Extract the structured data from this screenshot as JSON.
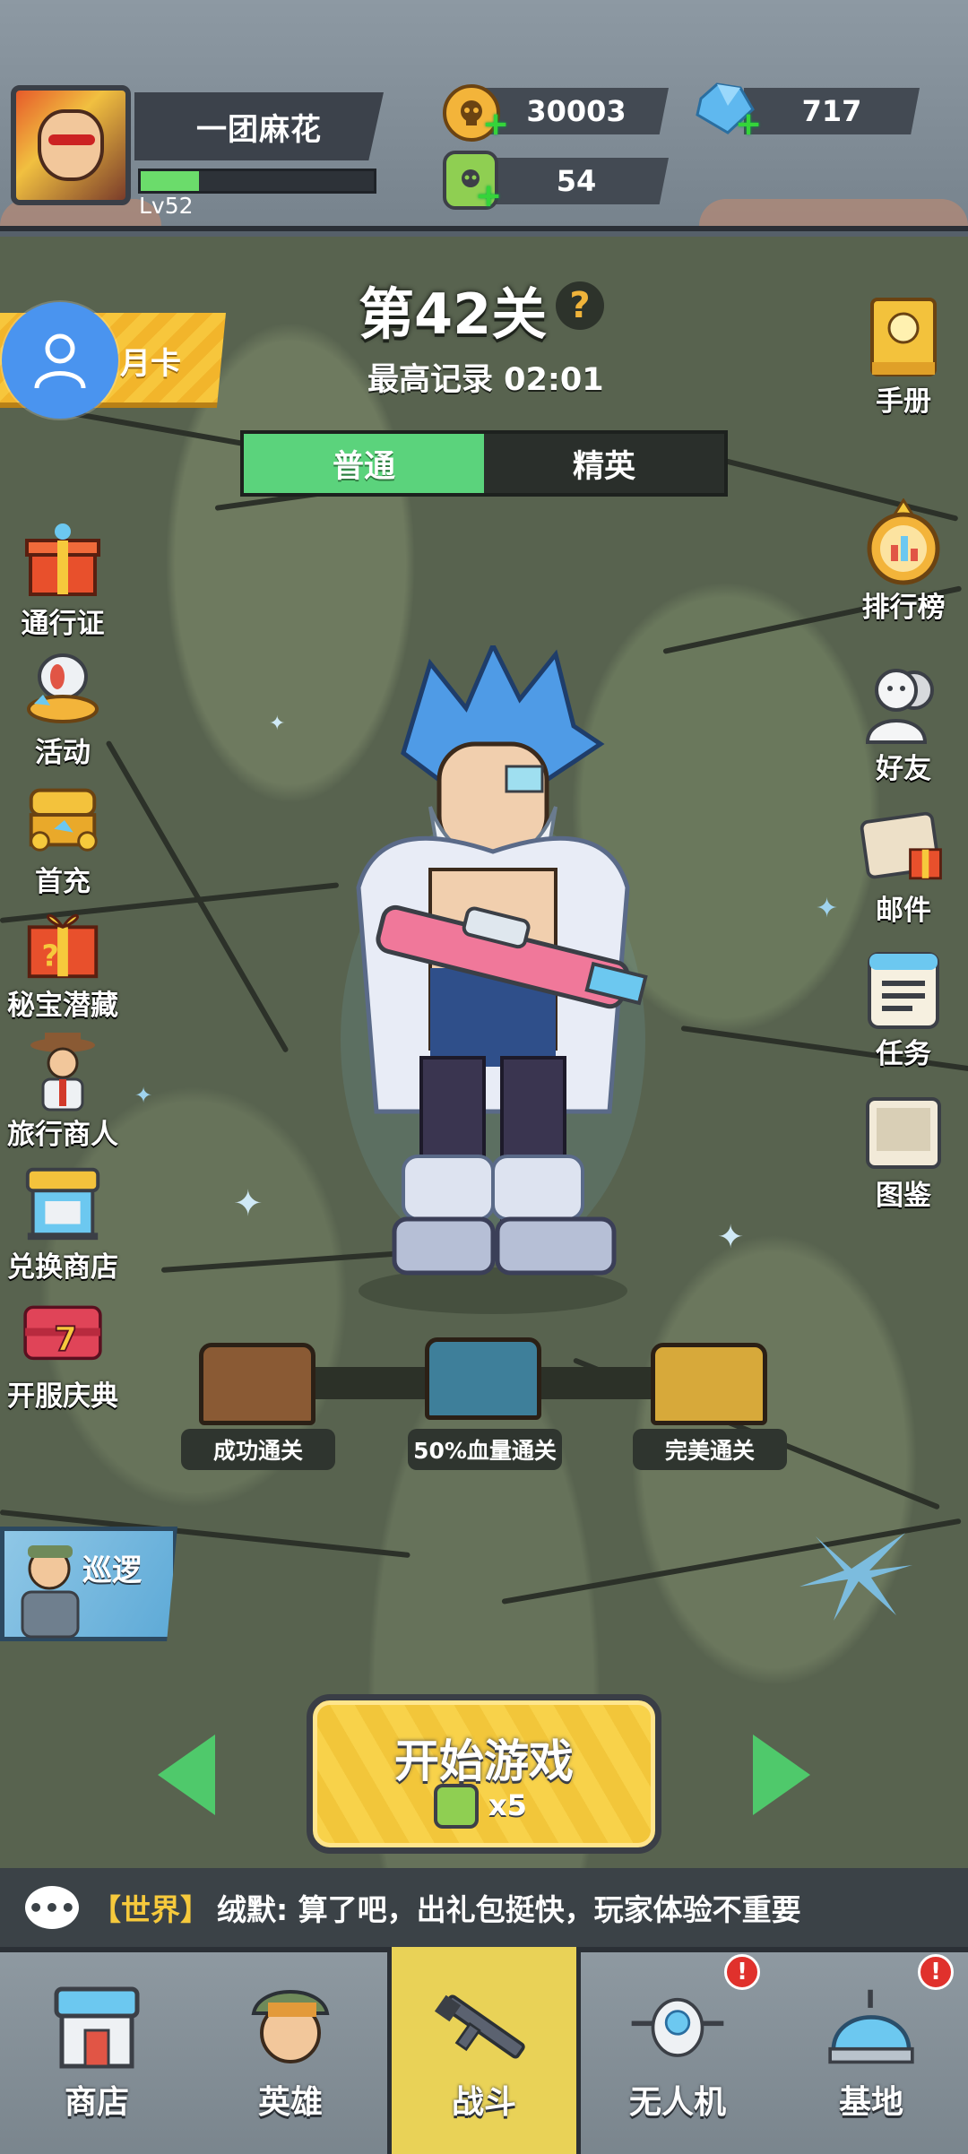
{
  "player": {
    "name": "一团麻花",
    "level": "Lv52",
    "xp_fraction": 0.25
  },
  "resources": {
    "gold": "30003",
    "diamonds": "717",
    "energy": "54"
  },
  "stage": {
    "title": "第42关",
    "best_record": "最高记录 02:01",
    "help": "?"
  },
  "mode_tabs": [
    {
      "label": "普通",
      "active": true
    },
    {
      "label": "精英",
      "active": false
    }
  ],
  "month_card": "月卡",
  "left_menu": [
    {
      "label": "通行证",
      "icon": "gift-box-icon"
    },
    {
      "label": "活动",
      "icon": "activity-icon"
    },
    {
      "label": "首充",
      "icon": "treasure-chest-icon"
    },
    {
      "label": "秘宝潜藏",
      "icon": "mystery-box-icon"
    },
    {
      "label": "旅行商人",
      "icon": "merchant-icon"
    },
    {
      "label": "兑换商店",
      "icon": "shop-stall-icon"
    },
    {
      "label": "开服庆典",
      "icon": "celebration-icon"
    }
  ],
  "right_menu": [
    {
      "label": "手册",
      "icon": "handbook-icon"
    },
    {
      "label": "排行榜",
      "icon": "trophy-icon"
    },
    {
      "label": "好友",
      "icon": "friends-icon"
    },
    {
      "label": "邮件",
      "icon": "mail-icon"
    },
    {
      "label": "任务",
      "icon": "task-icon"
    },
    {
      "label": "图鉴",
      "icon": "collection-icon"
    }
  ],
  "rewards": [
    {
      "label": "成功通关",
      "color": "#8a5a34"
    },
    {
      "label": "50%血量通关",
      "color": "#3e7f9a"
    },
    {
      "label": "完美通关",
      "color": "#d7a93a"
    }
  ],
  "patrol": "巡逻",
  "start": {
    "label": "开始游戏",
    "cost": "x5"
  },
  "chat": {
    "channel": "【世界】",
    "message": "绒默: 算了吧，出礼包挺快，玩家体验不重要"
  },
  "bottom_nav": [
    {
      "label": "商店",
      "icon": "shop-icon",
      "active": false,
      "badge": false
    },
    {
      "label": "英雄",
      "icon": "hero-icon",
      "active": false,
      "badge": false
    },
    {
      "label": "战斗",
      "icon": "rifle-icon",
      "active": true,
      "badge": false
    },
    {
      "label": "无人机",
      "icon": "drone-icon",
      "active": false,
      "badge": true
    },
    {
      "label": "基地",
      "icon": "base-dome-icon",
      "active": false,
      "badge": true
    }
  ],
  "badge_text": "!",
  "colors": {
    "accent_green": "#5bd37c",
    "gold": "#f6c93c",
    "badge_red": "#e0312c"
  }
}
